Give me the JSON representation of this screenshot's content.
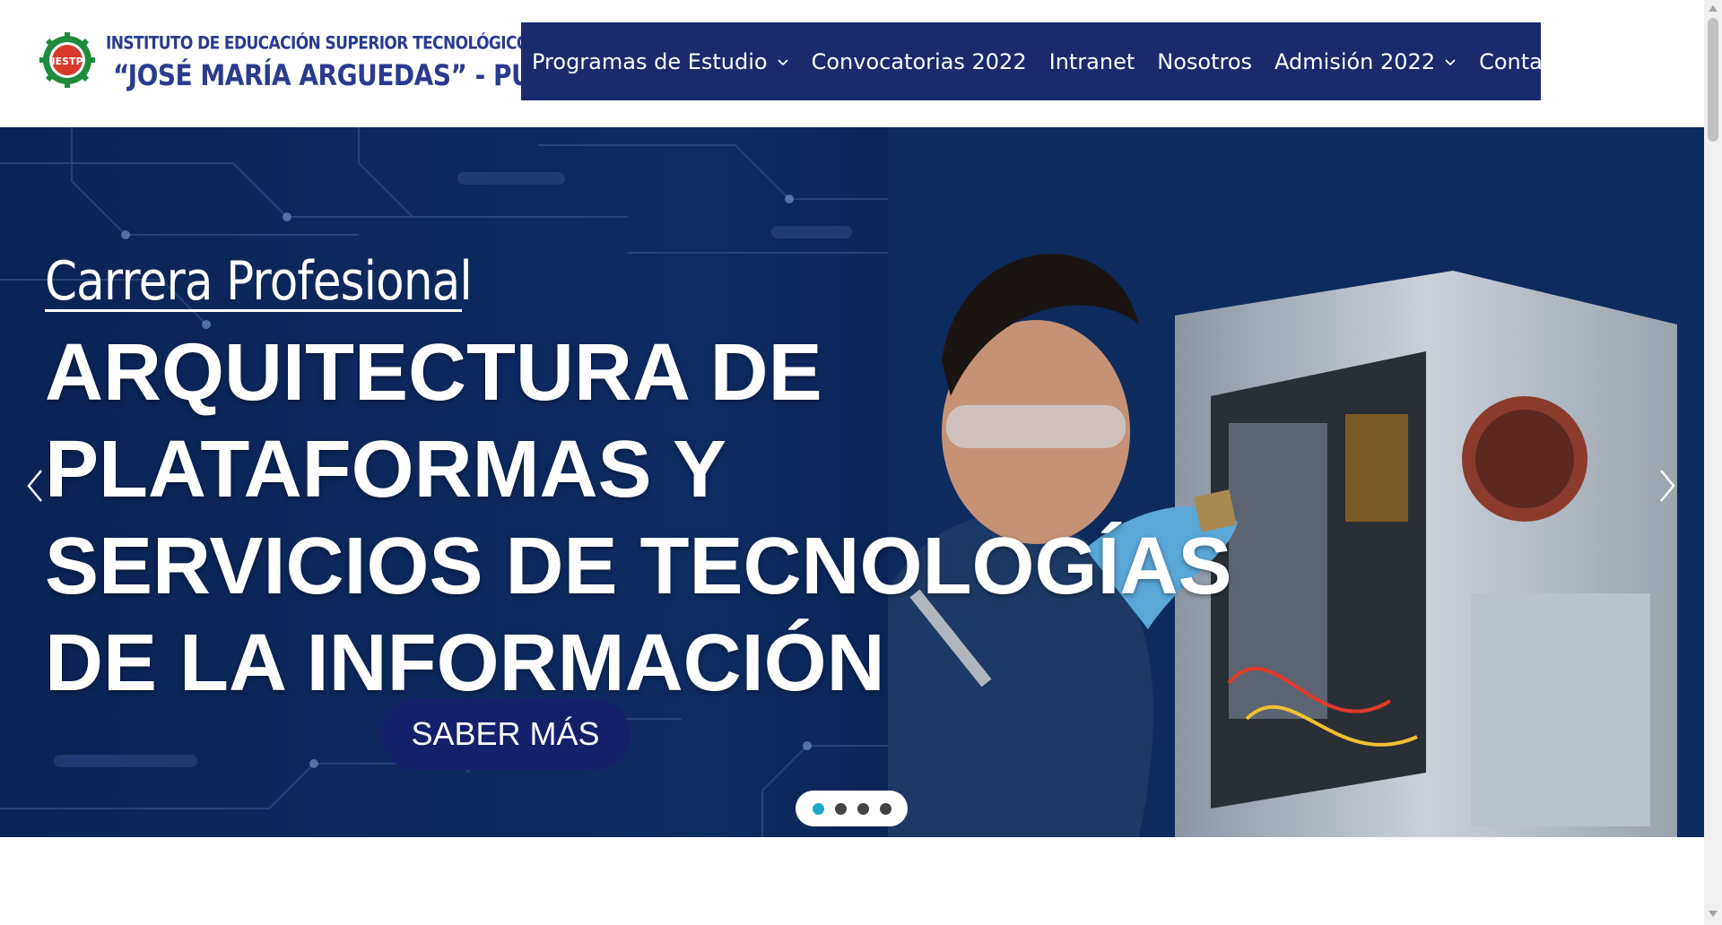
{
  "header": {
    "logo": {
      "seal_text": "IESTP",
      "line1": "INSTITUTO DE EDUCACIÓN SUPERIOR TECNOLÓGICO PÚBLICO",
      "line2": "“JOSÉ MARÍA ARGUEDAS” - PUQUIO"
    },
    "nav": [
      {
        "label": "Programas de Estudio",
        "has_dropdown": true,
        "icon": "chevron-down-icon"
      },
      {
        "label": "Convocatorias 2022",
        "has_dropdown": false
      },
      {
        "label": "Intranet",
        "has_dropdown": false
      },
      {
        "label": "Nosotros",
        "has_dropdown": false
      },
      {
        "label": "Admisión 2022",
        "has_dropdown": true,
        "icon": "chevron-down-icon"
      },
      {
        "label": "Contacto",
        "has_dropdown": false
      }
    ],
    "colors": {
      "nav_bg": "#1a2a6c",
      "logo_text": "#2a3b8f"
    }
  },
  "slider": {
    "kicker": "Carrera Profesional",
    "title_lines": [
      "ARQUITECTURA DE",
      "PLATAFORMAS Y",
      "SERVICIOS DE TECNOLOGÍAS",
      "DE LA INFORMACIÓN"
    ],
    "cta_label": "SABER MÁS",
    "prev_icon": "chevron-left-icon",
    "next_icon": "chevron-right-icon",
    "slide_count": 4,
    "active_slide": 1,
    "colors": {
      "cta_bg": "#15206b",
      "active_dot": "#1fa7c9",
      "dot": "#444444"
    }
  }
}
